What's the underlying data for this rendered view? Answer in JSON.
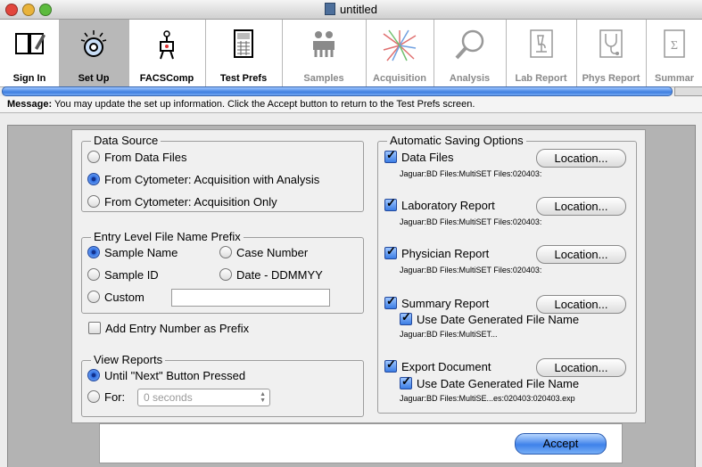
{
  "window": {
    "title": "untitled"
  },
  "toolbar": {
    "items": [
      {
        "label": "Sign In",
        "icon": "book-icon"
      },
      {
        "label": "Set Up",
        "icon": "setup-icon"
      },
      {
        "label": "FACSComp",
        "icon": "facscomp-icon"
      },
      {
        "label": "Test Prefs",
        "icon": "calculator-icon"
      },
      {
        "label": "Samples",
        "icon": "samples-icon"
      },
      {
        "label": "Acquisition",
        "icon": "acquisition-icon"
      },
      {
        "label": "Analysis",
        "icon": "magnifier-icon"
      },
      {
        "label": "Lab Report",
        "icon": "microscope-icon"
      },
      {
        "label": "Phys Report",
        "icon": "stethoscope-icon"
      },
      {
        "label": "Summar",
        "icon": "sigma-icon"
      }
    ],
    "active": "Set Up"
  },
  "message": {
    "label": "Message:",
    "text": "You may update the set up information. Click the Accept button to return to the Test Prefs screen."
  },
  "data_source": {
    "title": "Data Source",
    "options": [
      "From Data Files",
      "From Cytometer: Acquisition with Analysis",
      "From Cytometer: Acquisition Only"
    ],
    "selected": 1
  },
  "prefix": {
    "title": "Entry Level File Name Prefix",
    "sample_name": "Sample Name",
    "case_number": "Case Number",
    "sample_id": "Sample ID",
    "date": "Date - DDMMYY",
    "custom": "Custom",
    "custom_value": "",
    "selected": "Sample Name"
  },
  "add_entry": {
    "label": "Add Entry Number as Prefix",
    "checked": false
  },
  "view_reports": {
    "title": "View Reports",
    "until": "Until \"Next\" Button Pressed",
    "for_label": "For:",
    "for_value": "0 seconds",
    "selected": "until"
  },
  "auto_save": {
    "title": "Automatic Saving Options",
    "location_label": "Location...",
    "use_date_label": "Use Date Generated File Name",
    "items": [
      {
        "label": "Data Files",
        "path": "Jaguar:BD Files:MultiSET Files:020403:",
        "checked": true
      },
      {
        "label": "Laboratory Report",
        "path": "Jaguar:BD Files:MultiSET Files:020403:",
        "checked": true
      },
      {
        "label": "Physician Report",
        "path": "Jaguar:BD Files:MultiSET Files:020403:",
        "checked": true
      },
      {
        "label": "Summary Report",
        "path": "Jaguar:BD Files:MultiSET...",
        "checked": true
      },
      {
        "label": "Export Document",
        "path": "Jaguar:BD Files:MultiSE...es:020403:020403.exp",
        "checked": true
      }
    ]
  },
  "buttons": {
    "accept": "Accept"
  },
  "colors": {
    "accent": "#3f82ea",
    "toolbar_active": "#b8b8b8"
  }
}
